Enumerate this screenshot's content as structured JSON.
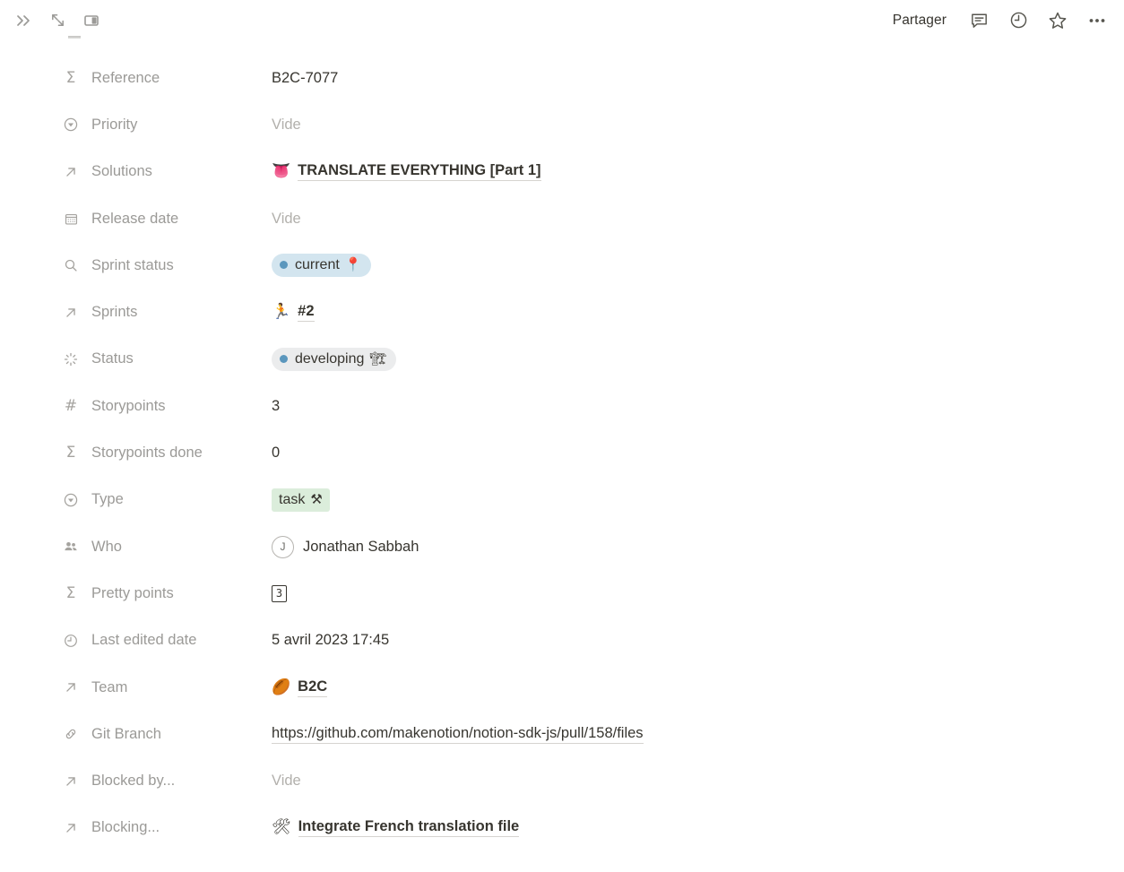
{
  "topbar": {
    "expand_icon": "double-chevron-right-icon",
    "fullscreen_icon": "expand-diagonal-icon",
    "sidebar_icon": "panel-toggle-icon",
    "share_label": "Partager",
    "comment_icon": "comment-icon",
    "history_icon": "clock-icon",
    "favorite_icon": "star-icon",
    "more_icon": "more-horizontal-icon"
  },
  "colors": {
    "pill_blue_bg": "#d3e5ef",
    "pill_gray_bg": "#ebeced",
    "pill_green_bg": "#dbeddb",
    "status_dot_blue": "#5b97bd",
    "text_primary": "#37352f",
    "text_muted": "#9b9a97",
    "text_empty": "#b2b0ac"
  },
  "properties": [
    {
      "id": "reference",
      "icon": "sigma-icon",
      "label": "Reference",
      "type": "text",
      "value": "B2C-7077"
    },
    {
      "id": "priority",
      "icon": "select-chevron-icon",
      "label": "Priority",
      "type": "empty",
      "value": "Vide"
    },
    {
      "id": "solutions",
      "icon": "relation-arrow-icon",
      "label": "Solutions",
      "type": "page-link",
      "emoji": "👅",
      "emoji_name": "tongue-emoji",
      "value": "TRANSLATE EVERYTHING [Part 1]"
    },
    {
      "id": "release-date",
      "icon": "calendar-icon",
      "label": "Release date",
      "type": "empty",
      "value": "Vide"
    },
    {
      "id": "sprint-status",
      "icon": "magnifier-icon",
      "label": "Sprint status",
      "type": "pill",
      "value": "current",
      "pill_emoji": "📍",
      "pill_emoji_name": "round-pushpin-emoji",
      "pill_bg": "#d3e5ef",
      "pill_dot": "#5b97bd",
      "pill_shape": "round"
    },
    {
      "id": "sprints",
      "icon": "relation-arrow-icon",
      "label": "Sprints",
      "type": "page-link",
      "emoji": "🏃",
      "emoji_name": "runner-emoji",
      "value": "#2"
    },
    {
      "id": "status",
      "icon": "status-burst-icon",
      "label": "Status",
      "type": "pill",
      "value": "developing",
      "pill_emoji": "🏗",
      "pill_emoji_name": "construction-crane-emoji",
      "pill_bg": "#ebeced",
      "pill_dot": "#5b97bd",
      "pill_shape": "round"
    },
    {
      "id": "storypoints",
      "icon": "hash-icon",
      "label": "Storypoints",
      "type": "number",
      "value": "3"
    },
    {
      "id": "storypoints-done",
      "icon": "sigma-icon",
      "label": "Storypoints done",
      "type": "number",
      "value": "0"
    },
    {
      "id": "type",
      "icon": "select-chevron-icon",
      "label": "Type",
      "type": "pill",
      "value": "task",
      "pill_emoji": "⚒",
      "pill_emoji_name": "hammer-and-pick-emoji",
      "pill_bg": "#dbeddb",
      "pill_dot": "",
      "pill_shape": "square"
    },
    {
      "id": "who",
      "icon": "people-icon",
      "label": "Who",
      "type": "person",
      "avatar_initial": "J",
      "value": "Jonathan Sabbah"
    },
    {
      "id": "pretty-points",
      "icon": "sigma-icon",
      "label": "Pretty points",
      "type": "keycap",
      "value": "3"
    },
    {
      "id": "last-edited-date",
      "icon": "clock-icon",
      "label": "Last edited date",
      "type": "date",
      "value": "5 avril 2023 17:45"
    },
    {
      "id": "team",
      "icon": "relation-arrow-icon",
      "label": "Team",
      "type": "page-link",
      "emoji": "🏉",
      "emoji_name": "rugby-football-emoji",
      "value": "B2C"
    },
    {
      "id": "git-branch",
      "icon": "link-chain-icon",
      "label": "Git Branch",
      "type": "url",
      "value": "https://github.com/makenotion/notion-sdk-js/pull/158/files"
    },
    {
      "id": "blocked-by",
      "icon": "relation-arrow-icon",
      "label": "Blocked by...",
      "type": "empty",
      "value": "Vide"
    },
    {
      "id": "blocking",
      "icon": "relation-arrow-icon",
      "label": "Blocking...",
      "type": "page-link",
      "emoji": "🛠",
      "emoji_name": "hammer-and-wrench-emoji",
      "value": "Integrate French translation file"
    }
  ]
}
